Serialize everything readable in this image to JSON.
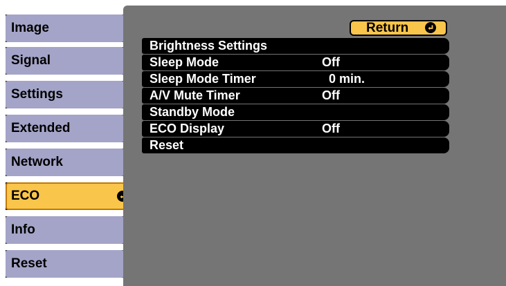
{
  "sidebar": {
    "items": [
      {
        "label": "Image"
      },
      {
        "label": "Signal"
      },
      {
        "label": "Settings"
      },
      {
        "label": "Extended"
      },
      {
        "label": "Network"
      },
      {
        "label": "ECO",
        "selected": true
      },
      {
        "label": "Info"
      },
      {
        "label": "Reset"
      }
    ]
  },
  "panel": {
    "return_label": "Return",
    "rows": [
      {
        "label": "Brightness Settings",
        "value": ""
      },
      {
        "label": "Sleep Mode",
        "value": "Off"
      },
      {
        "label": "Sleep Mode Timer",
        "value": "  0 min."
      },
      {
        "label": "A/V Mute Timer",
        "value": "Off"
      },
      {
        "label": "Standby Mode",
        "value": ""
      },
      {
        "label": "ECO Display",
        "value": "Off"
      },
      {
        "label": "Reset",
        "value": ""
      }
    ]
  },
  "colors": {
    "sidebar_item": "#a4a4c8",
    "selected": "#f9c54a",
    "panel": "#757575",
    "row": "#000000",
    "text_on_row": "#ffffff"
  }
}
